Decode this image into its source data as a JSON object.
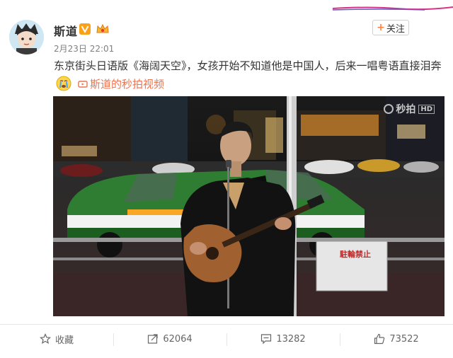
{
  "post": {
    "username": "斯道",
    "timestamp": "2月23日 22:01",
    "follow_label": "关注",
    "text": "东京街头日语版《海阔天空》，女孩开始不知道他是中国人，后来一唱粤语直接泪奔",
    "video_link": "斯道的秒拍视频",
    "verified_icon": "verified-v-icon",
    "member_icon": "crown-icon"
  },
  "video": {
    "watermark": "秒拍",
    "watermark_hd": "HD",
    "sign_text": "駐輪禁止"
  },
  "actions": {
    "favorite": "收藏",
    "repost": "62064",
    "comment": "13282",
    "like": "73522"
  },
  "colors": {
    "link": "#eb7350",
    "accent": "#ff8140",
    "taxi_green": "#2e7d32"
  }
}
